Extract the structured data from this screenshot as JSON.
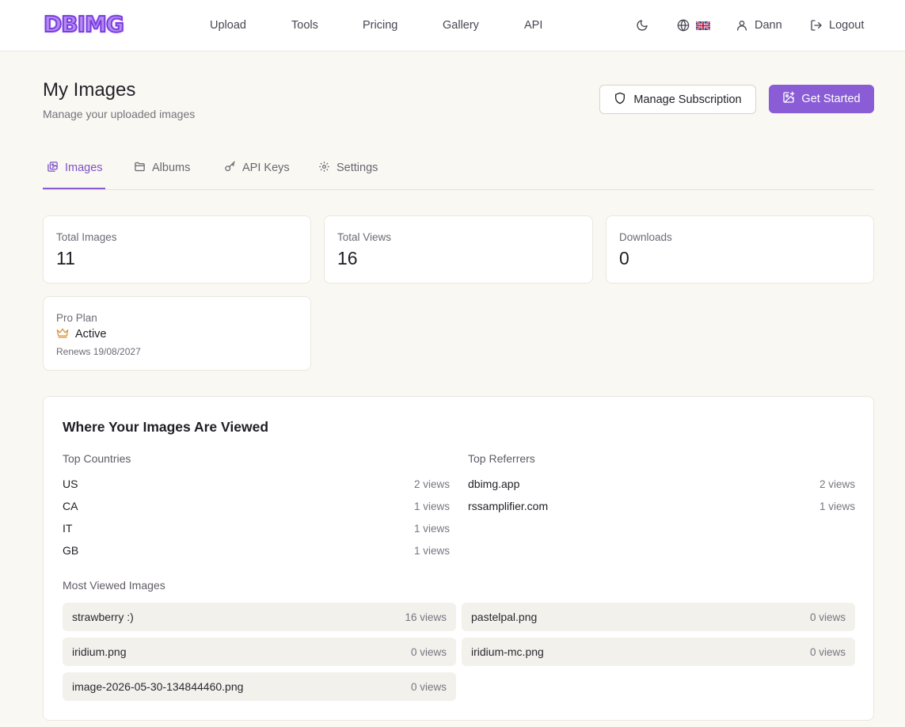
{
  "brand": {
    "logo_text": "DBIMG",
    "accent": "#8a5cd6"
  },
  "nav": {
    "links": [
      "Upload",
      "Tools",
      "Pricing",
      "Gallery",
      "API"
    ],
    "user_name": "Dann",
    "logout_label": "Logout"
  },
  "page": {
    "title": "My Images",
    "subtitle": "Manage your uploaded images",
    "manage_subscription_label": "Manage Subscription",
    "get_started_label": "Get Started"
  },
  "tabs": [
    {
      "label": "Images",
      "icon": "images-icon",
      "active": true
    },
    {
      "label": "Albums",
      "icon": "folder-icon",
      "active": false
    },
    {
      "label": "API Keys",
      "icon": "key-icon",
      "active": false
    },
    {
      "label": "Settings",
      "icon": "gear-icon",
      "active": false
    }
  ],
  "stats": [
    {
      "label": "Total Images",
      "value": "11"
    },
    {
      "label": "Total Views",
      "value": "16"
    },
    {
      "label": "Downloads",
      "value": "0"
    }
  ],
  "plan": {
    "label": "Pro Plan",
    "status": "Active",
    "renews": "Renews 19/08/2027"
  },
  "analytics": {
    "title": "Where Your Images Are Viewed",
    "countries_heading": "Top Countries",
    "referrers_heading": "Top Referrers",
    "most_viewed_heading": "Most Viewed Images",
    "countries": [
      {
        "name": "US",
        "views": "2 views"
      },
      {
        "name": "CA",
        "views": "1 views"
      },
      {
        "name": "IT",
        "views": "1 views"
      },
      {
        "name": "GB",
        "views": "1 views"
      }
    ],
    "referrers": [
      {
        "name": "dbimg.app",
        "views": "2 views"
      },
      {
        "name": "rssamplifier.com",
        "views": "1 views"
      }
    ],
    "most_viewed": [
      {
        "name": "strawberry :)",
        "views": "16 views"
      },
      {
        "name": "pastelpal.png",
        "views": "0 views"
      },
      {
        "name": "iridium.png",
        "views": "0 views"
      },
      {
        "name": "iridium-mc.png",
        "views": "0 views"
      },
      {
        "name": "image-2026-05-30-134844460.png",
        "views": "0 views"
      }
    ]
  }
}
